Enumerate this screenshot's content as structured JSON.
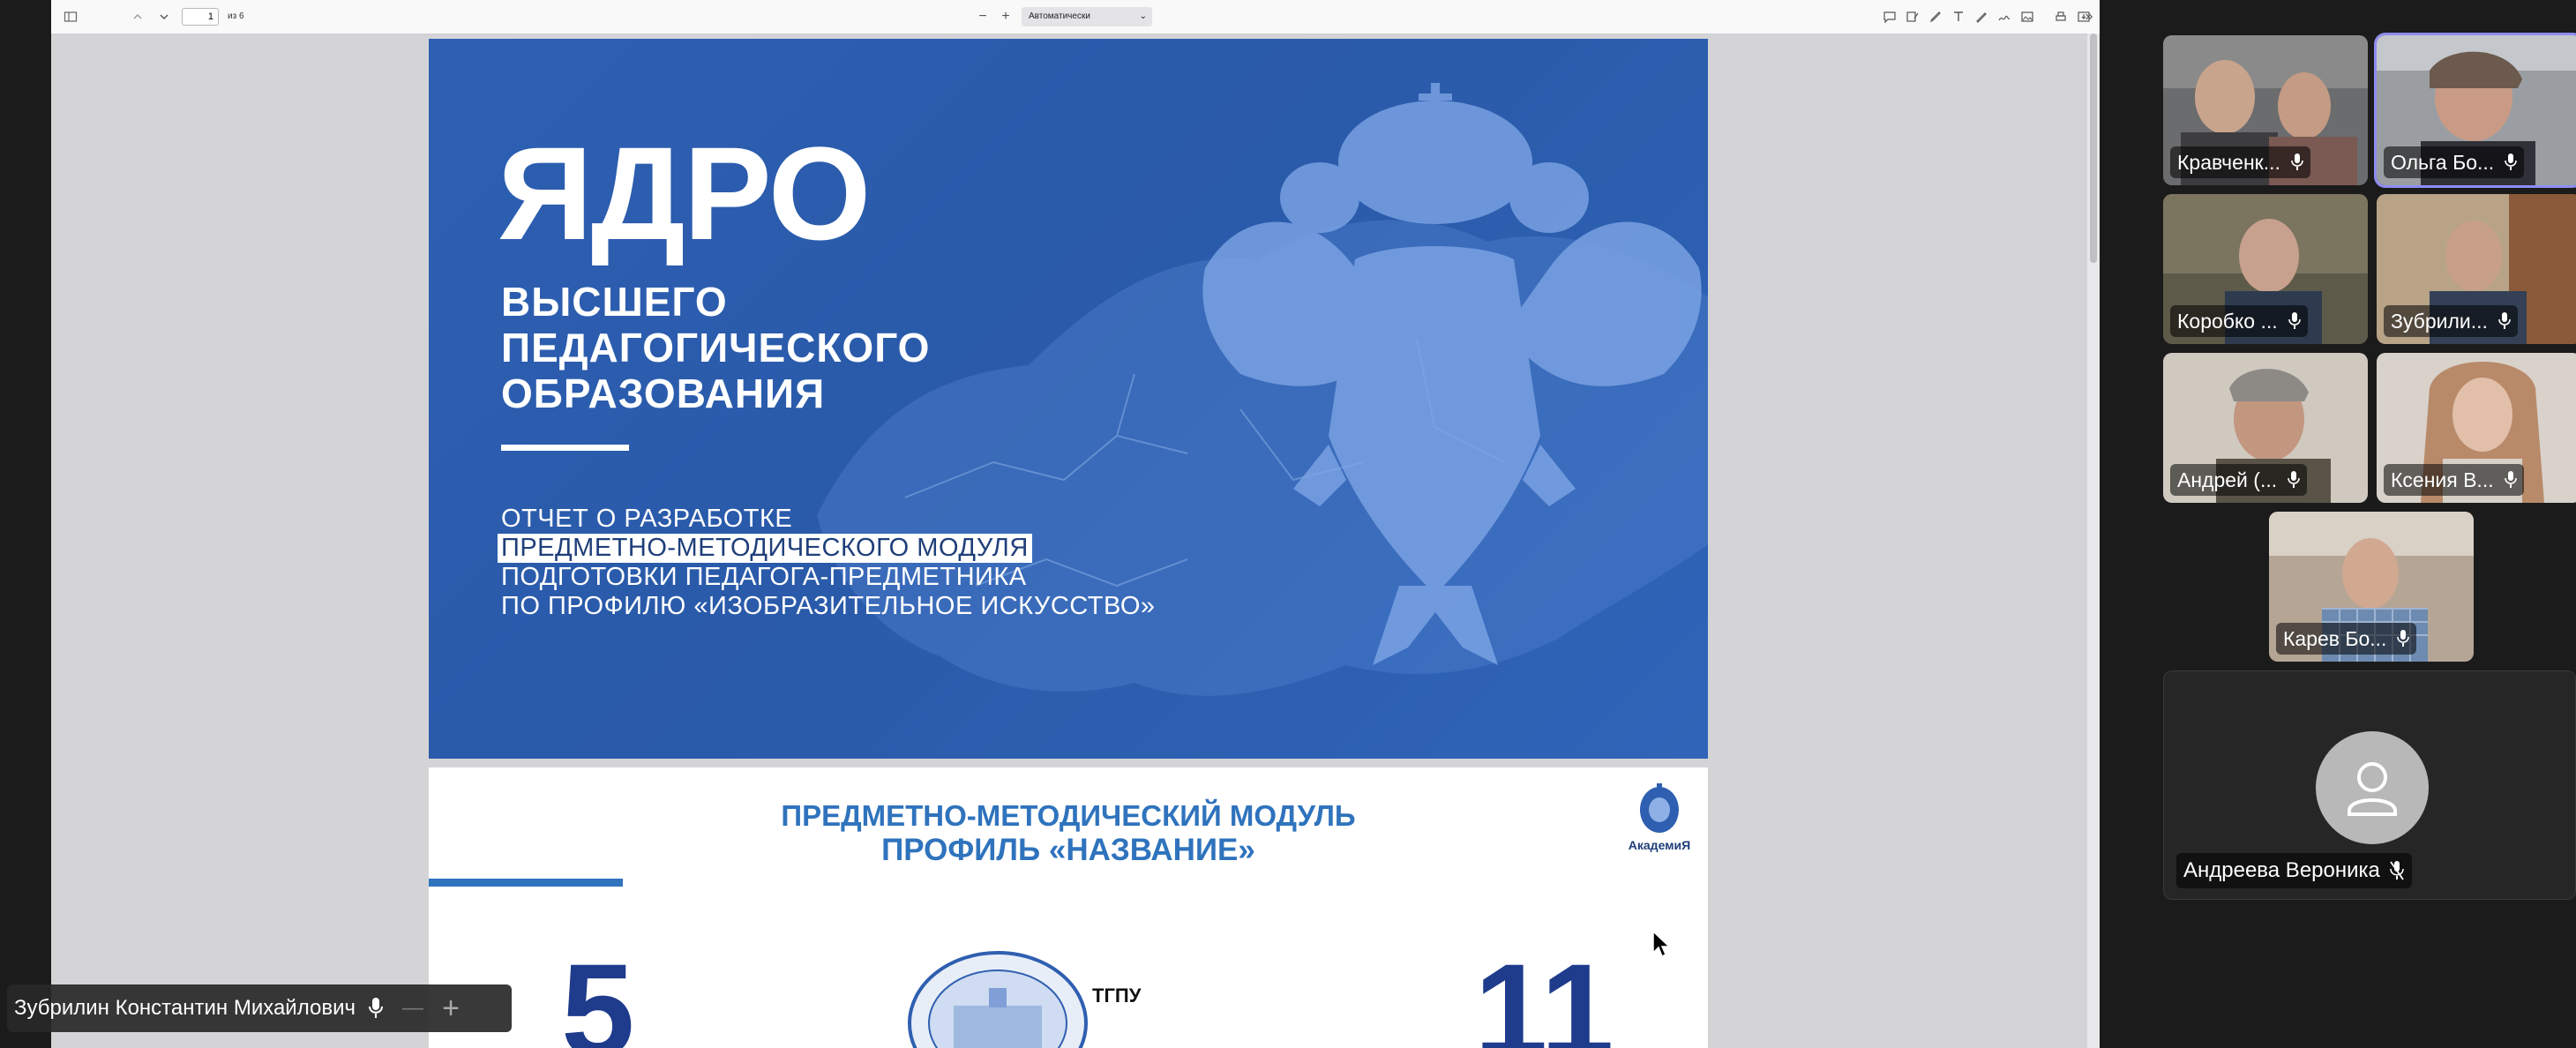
{
  "pdf_viewer": {
    "page_number": "1",
    "page_count": "из 6",
    "zoom": "Автоматически",
    "zoom_out": "−",
    "zoom_in": "+"
  },
  "slide_1": {
    "title": "ЯДРО",
    "subtitle_lines": [
      "ВЫСШЕГО",
      "ПЕДАГОГИЧЕСКОГО",
      "ОБРАЗОВАНИЯ"
    ],
    "report_lines": [
      "ОТЧЕТ О РАЗРАБОТКЕ",
      "ПРЕДМЕТНО-МЕТОДИЧЕСКОГО МОДУЛЯ",
      "ПОДГОТОВКИ ПЕДАГОГА-ПРЕДМЕТНИКА",
      "ПО ПРОФИЛЮ «ИЗОБРАЗИТЕЛЬНОЕ ИСКУССТВО»"
    ]
  },
  "slide_2": {
    "heading_line1": "ПРЕДМЕТНО-МЕТОДИЧЕСКИЙ МОДУЛЬ",
    "heading_line2": "ПРОФИЛЬ «НАЗВАНИЕ»",
    "academy_logo_text": "АкадемиЯ",
    "stat_left": "5",
    "stat_right": "11",
    "university_abbr": "ТГПУ"
  },
  "active_speaker": {
    "name": "Зубрилин Константин Михайлович"
  },
  "participants": [
    {
      "name": "Кравченк...",
      "muted": false,
      "active": false
    },
    {
      "name": "Ольга Бо...",
      "muted": false,
      "active": true
    },
    {
      "name": "Коробко ...",
      "muted": false,
      "active": false
    },
    {
      "name": "Зубрили...",
      "muted": false,
      "active": false
    },
    {
      "name": "Андрей (...",
      "muted": false,
      "active": false
    },
    {
      "name": "Ксения В...",
      "muted": false,
      "active": false
    },
    {
      "name": "Карев Бо...",
      "muted": false,
      "active": false
    },
    {
      "name": "Андреева Вероника",
      "muted": true,
      "active": false
    }
  ],
  "colors": {
    "slide1_bg": "#2d5fb3",
    "slide2_accent": "#2f73bd",
    "stat_color": "#1f3b8c",
    "active_tile_border": "#8e8cf2"
  },
  "icons": [
    "sidebar-toggle-icon",
    "chevron-up-icon",
    "chevron-down-icon",
    "comment-icon",
    "highlight-icon",
    "pen-icon",
    "text-icon",
    "draw-icon",
    "signature-icon",
    "image-icon",
    "print-icon",
    "save-icon",
    "more-tools-icon",
    "microphone-icon",
    "microphone-muted-icon",
    "add-icon",
    "user-avatar-icon"
  ]
}
